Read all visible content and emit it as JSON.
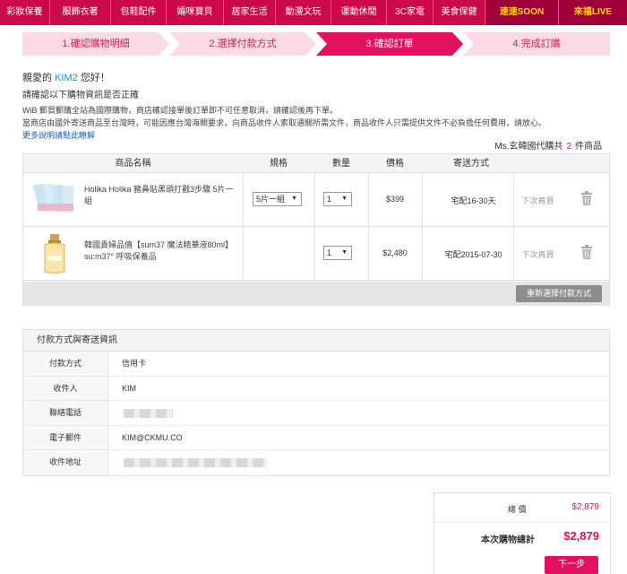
{
  "nav": {
    "items": [
      "彩妝保養",
      "服飾衣著",
      "包鞋配件",
      "孀咪寶貝",
      "居家生活",
      "動漫文玩",
      "運動休閒",
      "3C家電",
      "美食保健",
      "速速SOON",
      "來福LIVE"
    ]
  },
  "steps": [
    "1.確認購物明細",
    "2.選擇付款方式",
    "3.確認訂單",
    "4.完成訂購"
  ],
  "greeting": {
    "prefix": "親愛的",
    "name": "KIM2",
    "suffix": "您好！"
  },
  "confirm_text": "請確認以下購物資訊是否正確",
  "notices": [
    "WiB 郵貿郵購全站為國際購物，商店確認接單後訂單即不可任意取消，請確認後再下單。",
    "當商店由國外寄送商品至台灣時，可能因應台灣海關要求，向商品收件人索取通關所需文件，商品收件人只需提供文件不必負擔任何費用，請放心。"
  ],
  "more_link": "更多說明請點此瞭解",
  "buyer": {
    "prefix": "Ms.玄韓國代購共",
    "count": "2",
    "suffix": "件商品"
  },
  "table": {
    "headers": [
      "商品名稱",
      "規格",
      "數量",
      "價格",
      "寄送方式"
    ],
    "rows": [
      {
        "name": "Holika Holika 豬鼻貼黑頭打戳3步驟 5片一組",
        "spec": "5片一組",
        "qty": "1",
        "price": "$399",
        "shipping": "宅配16-30天",
        "later": "下次再買"
      },
      {
        "name": "韓國貴婦品僖【sum37 魔法精華液80ml】 su:m37° 呼吸保養品",
        "spec": "",
        "qty": "1",
        "price": "$2,480",
        "shipping": "宅配2015-07-30",
        "later": "下次再買"
      }
    ],
    "reselect_label": "重新選擇付款方式"
  },
  "payment": {
    "title": "付款方式與寄送資訊",
    "rows": [
      {
        "label": "付款方式",
        "value": "信用卡"
      },
      {
        "label": "收件人",
        "value": "KIM"
      },
      {
        "label": "聯絡電話",
        "value": ""
      },
      {
        "label": "電子郵件",
        "value": "KIM@CKMU.CO"
      },
      {
        "label": "收件地址",
        "value": ""
      }
    ]
  },
  "summary": {
    "total_label": "總 價",
    "total_value": "$2,879",
    "grand_label": "本次購物總計",
    "grand_value": "$2,879",
    "next_label": "下一步"
  },
  "colors": {
    "brand": "#cc0a4b",
    "accent": "#e3105f",
    "link": "#2a8bd6"
  }
}
